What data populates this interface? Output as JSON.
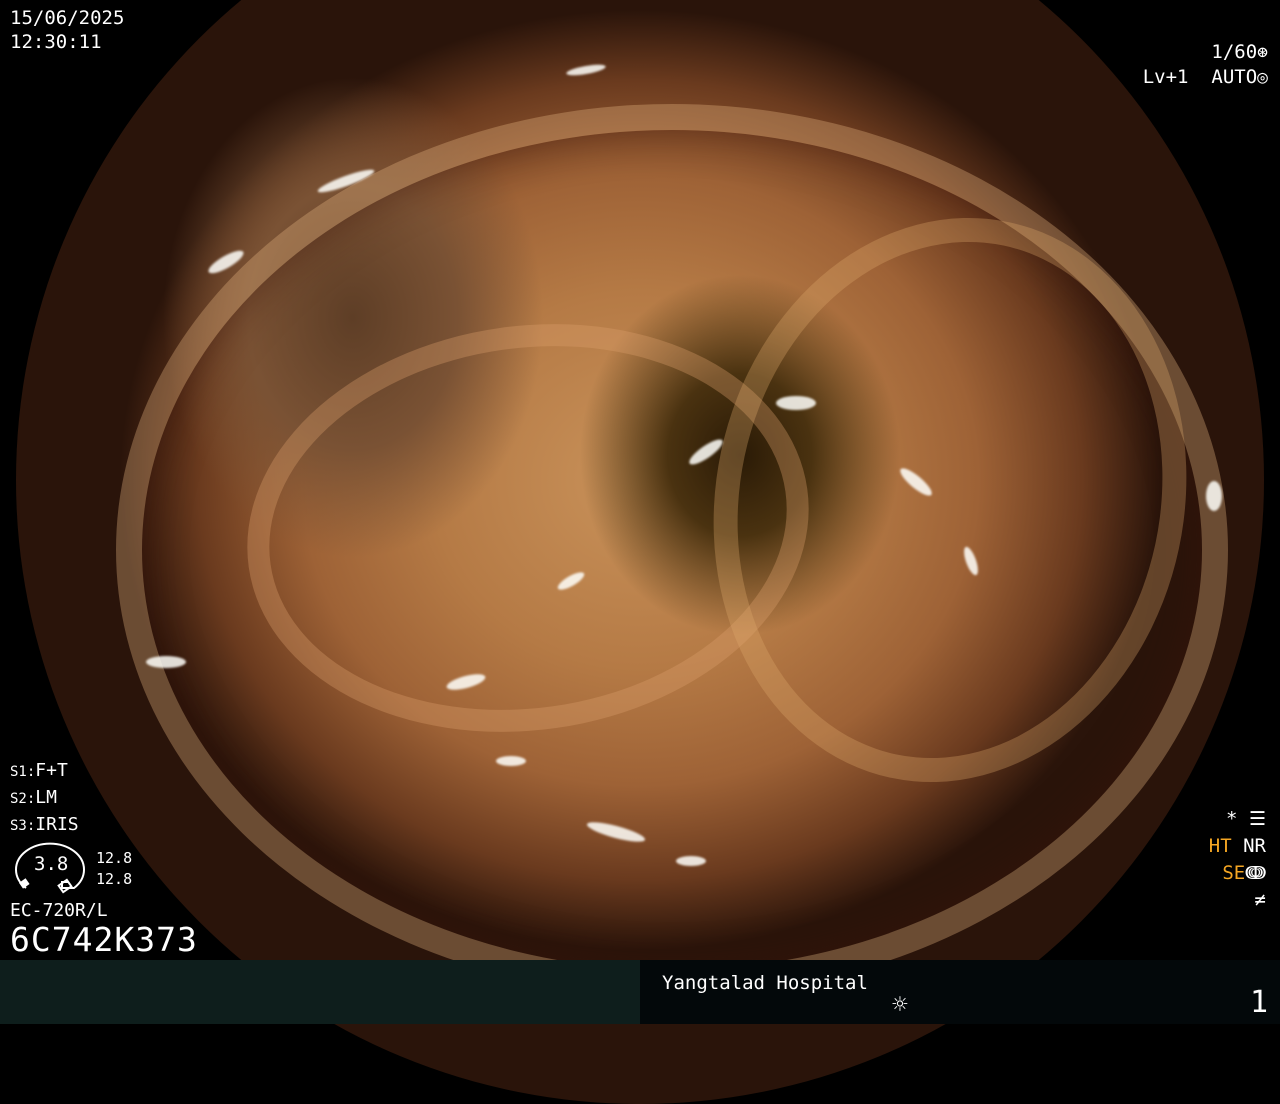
{
  "header": {
    "date": "15/06/2025",
    "time": "12:30:11",
    "shutter": "1/60",
    "shutter_icon": "aperture-icon",
    "level": "Lv+1",
    "mode": "AUTO",
    "mode_icon": "iris-icon"
  },
  "scope_settings": {
    "s1_label": "S1:",
    "s1_value": "F+T",
    "s2_label": "S2:",
    "s2_value": "LM",
    "s3_label": "S3:",
    "s3_value": "IRIS",
    "gauge_value": "3.8",
    "gauge_right_top": "12.8",
    "gauge_right_bottom": "12.8",
    "model": "EC-720R/L",
    "serial": "6C742K373"
  },
  "status_right": {
    "star": "*",
    "settings_icon": "settings-panel-icon",
    "ht": "HT",
    "nr": "NR",
    "se": "SE",
    "se_icon": "contrast-curve-icon",
    "not_equal_icon": "not-equal-icon"
  },
  "footer": {
    "hospital": "Yangtalad Hospital",
    "brightness_icon": "brightness-icon",
    "page": "1"
  },
  "colors": {
    "accent_orange": "#f5a623",
    "footer_left_bg": "#0e1e1c",
    "footer_right_bg": "#03080a"
  }
}
